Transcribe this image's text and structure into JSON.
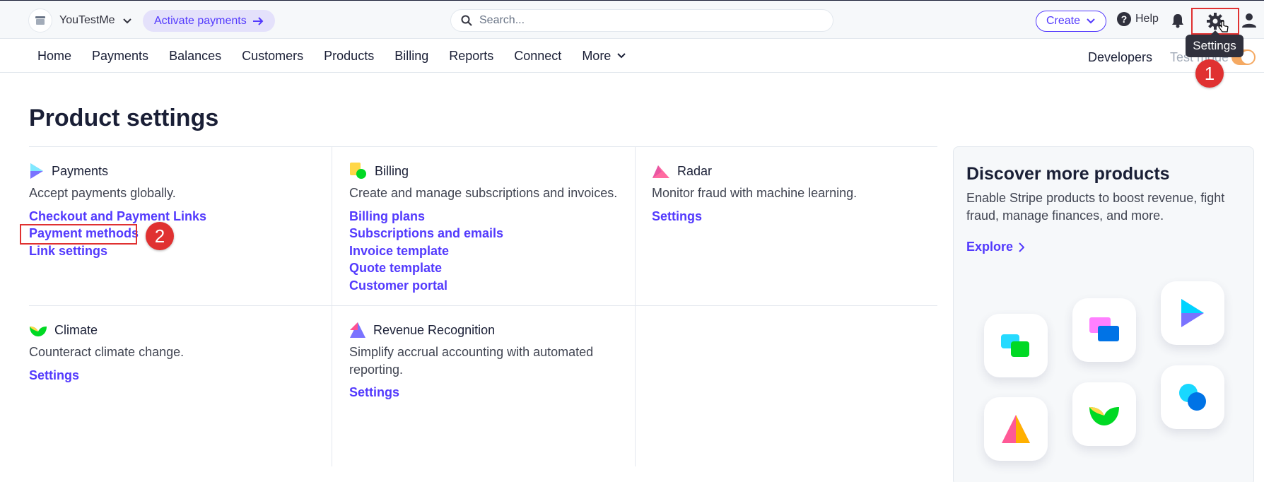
{
  "account": {
    "name": "YouTestMe",
    "activate_label": "Activate payments"
  },
  "search": {
    "placeholder": "Search..."
  },
  "topbar": {
    "create_label": "Create",
    "help_label": "Help",
    "settings_tooltip": "Settings"
  },
  "nav": {
    "items": [
      "Home",
      "Payments",
      "Balances",
      "Customers",
      "Products",
      "Billing",
      "Reports",
      "Connect",
      "More"
    ],
    "developers": "Developers",
    "test_mode": "Test mode"
  },
  "annotations": {
    "step1": "1",
    "step2": "2"
  },
  "page": {
    "title": "Product settings"
  },
  "cards": {
    "payments": {
      "title": "Payments",
      "desc": "Accept payments globally.",
      "links": [
        "Checkout and Payment Links",
        "Payment methods",
        "Link settings"
      ]
    },
    "billing": {
      "title": "Billing",
      "desc": "Create and manage subscriptions and invoices.",
      "links": [
        "Billing plans",
        "Subscriptions and emails",
        "Invoice template",
        "Quote template",
        "Customer portal"
      ]
    },
    "radar": {
      "title": "Radar",
      "desc": "Monitor fraud with machine learning.",
      "links": [
        "Settings"
      ]
    },
    "climate": {
      "title": "Climate",
      "desc": "Counteract climate change.",
      "links": [
        "Settings"
      ]
    },
    "revrec": {
      "title": "Revenue Recognition",
      "desc": "Simplify accrual accounting with automated reporting.",
      "links": [
        "Settings"
      ]
    }
  },
  "discover": {
    "title": "Discover more products",
    "desc": "Enable Stripe products to boost revenue, fight fraud, manage finances, and more.",
    "link": "Explore"
  },
  "colors": {
    "accent": "#533afd",
    "annotation": "#e03131",
    "toggle": "#f5a962"
  }
}
